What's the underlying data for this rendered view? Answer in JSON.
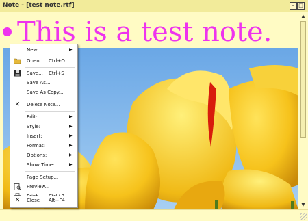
{
  "window": {
    "title": "Note - [test note.rtf]"
  },
  "title_buttons": {
    "min": "–",
    "restore": "□",
    "close": "×"
  },
  "note": {
    "text": "This is a test note."
  },
  "colors": {
    "note_text": "#ee33ee",
    "background": "#fffbc4",
    "titlebar": "#f2eb9a"
  },
  "menu": {
    "items": [
      {
        "label": "New:",
        "shortcut": "",
        "submenu": true,
        "icon": ""
      },
      {
        "label": "Open...",
        "shortcut": "Ctrl+O",
        "submenu": false,
        "icon": "open-folder-icon"
      },
      {
        "label": "Save...",
        "shortcut": "Ctrl+S",
        "submenu": false,
        "icon": "floppy-disk-icon"
      },
      {
        "label": "Save As...",
        "shortcut": "",
        "submenu": false,
        "icon": ""
      },
      {
        "label": "Save As Copy...",
        "shortcut": "",
        "submenu": false,
        "icon": ""
      },
      {
        "label": "Delete Note...",
        "shortcut": "",
        "submenu": false,
        "icon": "delete-x-icon"
      },
      {
        "label": "Edit:",
        "shortcut": "",
        "submenu": true,
        "icon": ""
      },
      {
        "label": "Style:",
        "shortcut": "",
        "submenu": true,
        "icon": ""
      },
      {
        "label": "Insert:",
        "shortcut": "",
        "submenu": true,
        "icon": ""
      },
      {
        "label": "Format:",
        "shortcut": "",
        "submenu": true,
        "icon": ""
      },
      {
        "label": "Options:",
        "shortcut": "",
        "submenu": true,
        "icon": ""
      },
      {
        "label": "Show Time:",
        "shortcut": "",
        "submenu": true,
        "icon": ""
      },
      {
        "label": "Page Setup...",
        "shortcut": "",
        "submenu": false,
        "icon": ""
      },
      {
        "label": "Preview...",
        "shortcut": "",
        "submenu": false,
        "icon": "print-preview-icon"
      },
      {
        "label": "Print...",
        "shortcut": "Ctrl+P",
        "submenu": false,
        "icon": "printer-icon"
      },
      {
        "label": "Close",
        "shortcut": "Alt+F4",
        "submenu": false,
        "icon": "close-x-icon"
      }
    ]
  }
}
